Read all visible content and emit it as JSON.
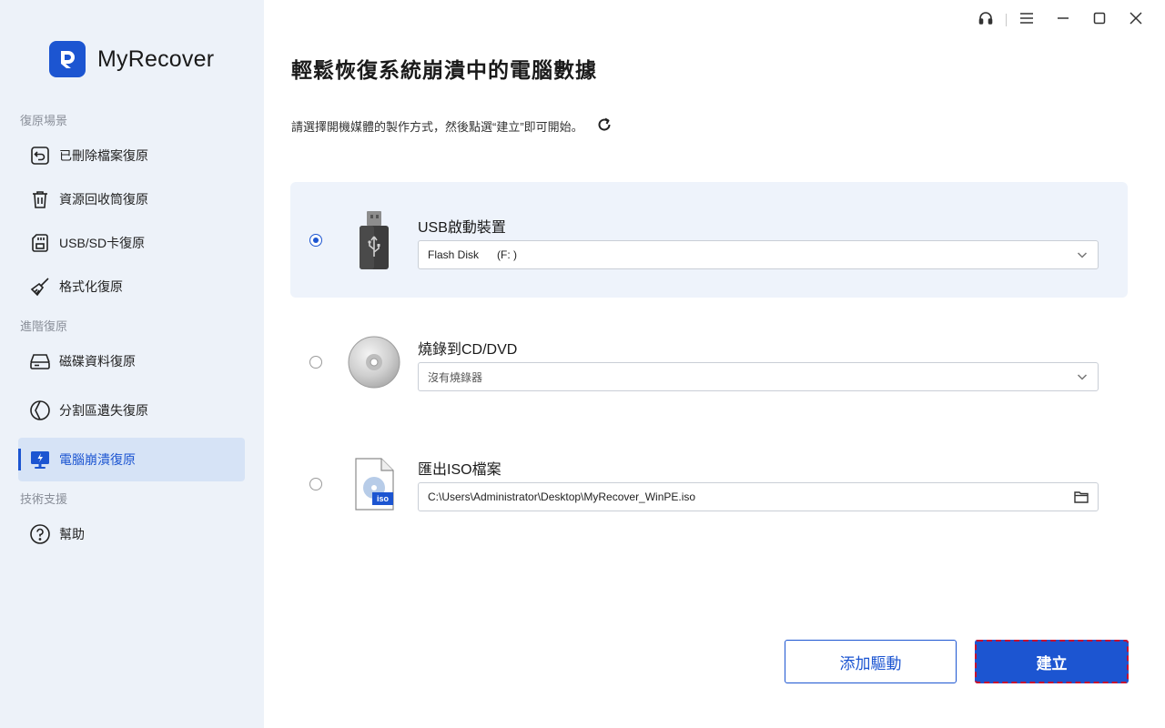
{
  "app": {
    "name": "MyRecover"
  },
  "sidebar": {
    "sections": {
      "recovery_scenes": "復原場景",
      "advanced": "進階復原",
      "support": "技術支援"
    },
    "items": [
      {
        "label": "已刪除檔案復原",
        "icon": "undo-file-icon"
      },
      {
        "label": "資源回收筒復原",
        "icon": "trash-icon"
      },
      {
        "label": "USB/SD卡復原",
        "icon": "sd-card-icon"
      },
      {
        "label": "格式化復原",
        "icon": "broom-icon"
      },
      {
        "label": "磁碟資料復原",
        "icon": "hard-drive-icon"
      },
      {
        "label": "分割區遺失復原",
        "icon": "partition-icon"
      },
      {
        "label": "電腦崩潰復原",
        "icon": "crashed-monitor-icon",
        "active": true
      },
      {
        "label": "幫助",
        "icon": "help-icon"
      }
    ]
  },
  "main": {
    "title": "輕鬆恢復系統崩潰中的電腦數據",
    "subtitle": "請選擇開機媒體的製作方式，然後點選“建立”即可開始。",
    "options": [
      {
        "title": "USB啟動裝置",
        "field_value": "Flash Disk      (F: )",
        "selected": true
      },
      {
        "title": "燒錄到CD/DVD",
        "field_value": "沒有燒錄器",
        "selected": false
      },
      {
        "title": "匯出ISO檔案",
        "field_value": "C:\\Users\\Administrator\\Desktop\\MyRecover_WinPE.iso",
        "selected": false,
        "badge": "iso"
      }
    ]
  },
  "buttons": {
    "add_driver": "添加驅動",
    "create": "建立"
  },
  "colors": {
    "accent": "#1c55d1",
    "sidebar_bg": "#edf2f9",
    "selected_bg": "#eef3fb",
    "focus_outline": "#c8102e"
  }
}
